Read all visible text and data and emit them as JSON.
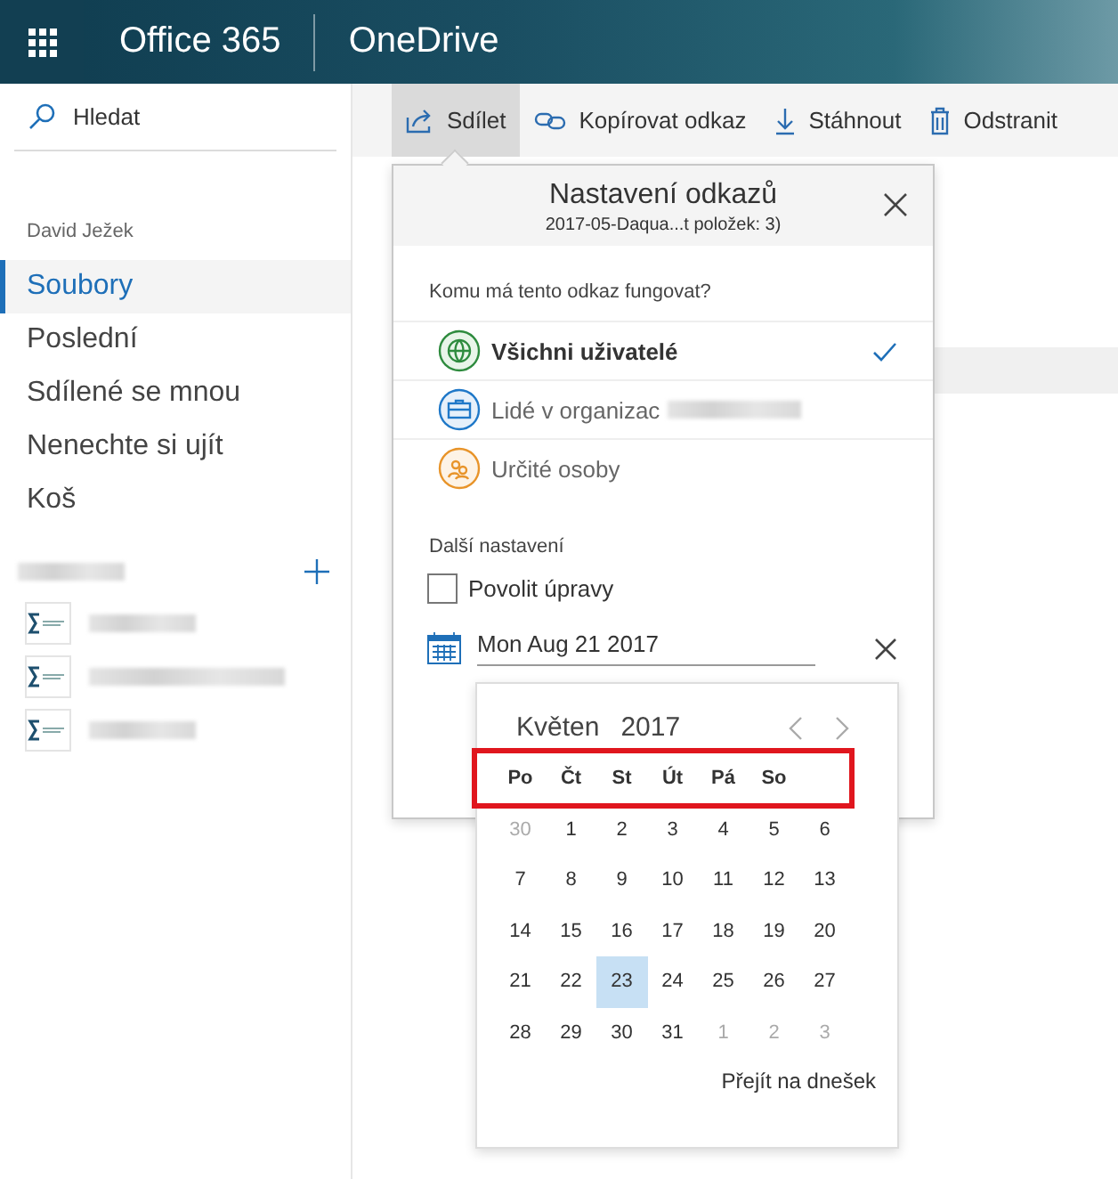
{
  "header": {
    "suite": "Office 365",
    "app": "OneDrive"
  },
  "sidebar": {
    "search": "Hledat",
    "user": "David Ježek",
    "items": [
      {
        "label": "Soubory",
        "selected": true
      },
      {
        "label": "Poslední",
        "selected": false
      },
      {
        "label": "Sdílené se mnou",
        "selected": false
      },
      {
        "label": "Nenechte si ujít",
        "selected": false
      },
      {
        "label": "Koš",
        "selected": false
      }
    ]
  },
  "commands": [
    {
      "label": "Sdílet",
      "selected": true
    },
    {
      "label": "Kopírovat odkaz",
      "selected": false
    },
    {
      "label": "Stáhnout",
      "selected": false
    },
    {
      "label": "Odstranit",
      "selected": false
    }
  ],
  "dialog": {
    "title": "Nastavení odkazů",
    "subtitle": "2017-05-Daqua...t položek: 3)",
    "question": "Komu má tento odkaz fungovat?",
    "options": [
      {
        "label": "Všichni uživatelé",
        "selected": true,
        "redacted": false
      },
      {
        "label": "Lidé v organizac",
        "selected": false,
        "redacted": true
      },
      {
        "label": "Určité osoby",
        "selected": false,
        "redacted": false
      }
    ],
    "more_settings": "Další nastavení",
    "allow_edit": {
      "label": "Povolit úpravy",
      "checked": false
    },
    "expiry": "Mon Aug 21 2017"
  },
  "calendar": {
    "month": "Květen",
    "year": "2017",
    "weekdays": [
      "Po",
      "Čt",
      "St",
      "Út",
      "Pá",
      "So"
    ],
    "weeks": [
      [
        {
          "day": "30",
          "other_month": true,
          "selected": false
        },
        {
          "day": "1",
          "other_month": false,
          "selected": false
        },
        {
          "day": "2",
          "other_month": false,
          "selected": false
        },
        {
          "day": "3",
          "other_month": false,
          "selected": false
        },
        {
          "day": "4",
          "other_month": false,
          "selected": false
        },
        {
          "day": "5",
          "other_month": false,
          "selected": false
        },
        {
          "day": "6",
          "other_month": false,
          "selected": false
        }
      ],
      [
        {
          "day": "7",
          "other_month": false,
          "selected": false
        },
        {
          "day": "8",
          "other_month": false,
          "selected": false
        },
        {
          "day": "9",
          "other_month": false,
          "selected": false
        },
        {
          "day": "10",
          "other_month": false,
          "selected": false
        },
        {
          "day": "11",
          "other_month": false,
          "selected": false
        },
        {
          "day": "12",
          "other_month": false,
          "selected": false
        },
        {
          "day": "13",
          "other_month": false,
          "selected": false
        }
      ],
      [
        {
          "day": "14",
          "other_month": false,
          "selected": false
        },
        {
          "day": "15",
          "other_month": false,
          "selected": false
        },
        {
          "day": "16",
          "other_month": false,
          "selected": false
        },
        {
          "day": "17",
          "other_month": false,
          "selected": false
        },
        {
          "day": "18",
          "other_month": false,
          "selected": false
        },
        {
          "day": "19",
          "other_month": false,
          "selected": false
        },
        {
          "day": "20",
          "other_month": false,
          "selected": false
        }
      ],
      [
        {
          "day": "21",
          "other_month": false,
          "selected": false
        },
        {
          "day": "22",
          "other_month": false,
          "selected": false
        },
        {
          "day": "23",
          "other_month": false,
          "selected": true
        },
        {
          "day": "24",
          "other_month": false,
          "selected": false
        },
        {
          "day": "25",
          "other_month": false,
          "selected": false
        },
        {
          "day": "26",
          "other_month": false,
          "selected": false
        },
        {
          "day": "27",
          "other_month": false,
          "selected": false
        }
      ],
      [
        {
          "day": "28",
          "other_month": false,
          "selected": false
        },
        {
          "day": "29",
          "other_month": false,
          "selected": false
        },
        {
          "day": "30",
          "other_month": false,
          "selected": false
        },
        {
          "day": "31",
          "other_month": false,
          "selected": false
        },
        {
          "day": "1",
          "other_month": true,
          "selected": false
        },
        {
          "day": "2",
          "other_month": true,
          "selected": false
        },
        {
          "day": "3",
          "other_month": true,
          "selected": false
        }
      ]
    ],
    "today_link": "Přejít na dnešek"
  }
}
